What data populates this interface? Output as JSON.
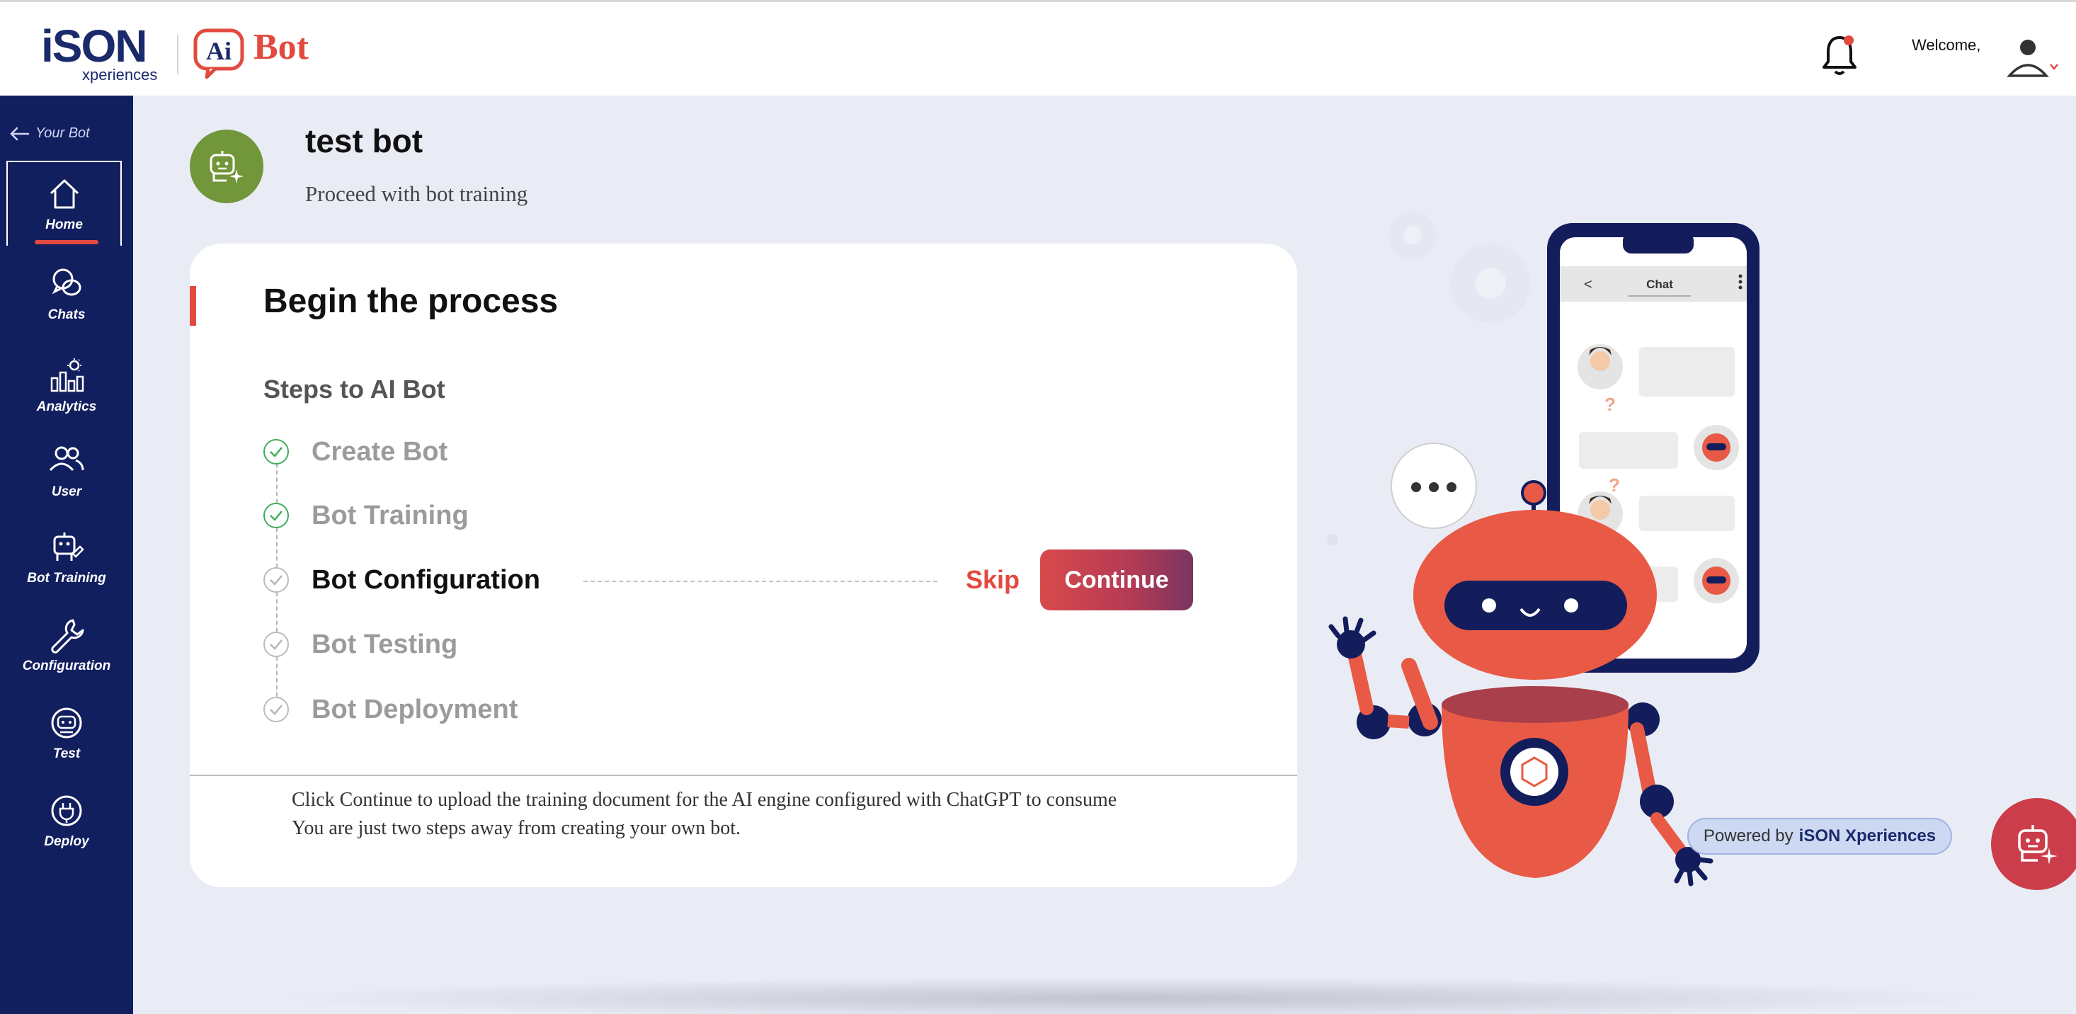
{
  "header": {
    "brand_ison": "iSON",
    "brand_xperiences": "xperiences",
    "brand_ai": "Ai",
    "brand_bot": "Bot",
    "welcome": "Welcome,"
  },
  "sidebar": {
    "back_label": "Your Bot",
    "items": [
      {
        "label": "Home",
        "icon": "home-icon",
        "active": true
      },
      {
        "label": "Chats",
        "icon": "chats-icon"
      },
      {
        "label": "Analytics",
        "icon": "analytics-icon"
      },
      {
        "label": "User",
        "icon": "user-icon"
      },
      {
        "label": "Bot Training",
        "icon": "bot-training-icon"
      },
      {
        "label": "Configuration",
        "icon": "wrench-icon"
      },
      {
        "label": "Test",
        "icon": "test-icon"
      },
      {
        "label": "Deploy",
        "icon": "plug-icon"
      }
    ]
  },
  "page": {
    "title": "test bot",
    "subtitle": "Proceed with bot training"
  },
  "card": {
    "title": "Begin the process",
    "steps_heading": "Steps to AI Bot",
    "steps": [
      {
        "label": "Create Bot",
        "status": "done"
      },
      {
        "label": "Bot Training",
        "status": "done"
      },
      {
        "label": "Bot Configuration",
        "status": "current"
      },
      {
        "label": "Bot Testing",
        "status": "pending"
      },
      {
        "label": "Bot Deployment",
        "status": "pending"
      }
    ],
    "skip_label": "Skip",
    "continue_label": "Continue",
    "note_line1": "Click Continue to upload the training document for the AI engine configured with ChatGPT to consume",
    "note_line2": "You are just two steps away from creating your own bot."
  },
  "illustration": {
    "phone_header": "Chat",
    "phone_back": "<"
  },
  "footer": {
    "powered_prefix": "Powered by",
    "powered_brand": "iSON Xperiences"
  },
  "colors": {
    "sidebar_bg": "#121f5e",
    "accent_red": "#e24a3f",
    "done_green": "#3fae5a",
    "title_icon_bg": "#72963a",
    "page_bg": "#e9ecf5"
  }
}
